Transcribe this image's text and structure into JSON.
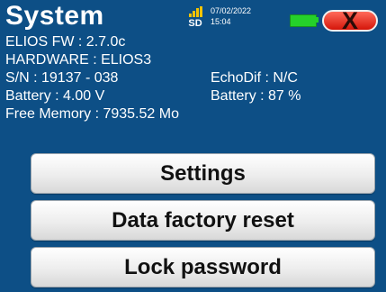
{
  "header": {
    "title": "System",
    "sd_label": "SD",
    "date": "07/02/2022",
    "time": "15:04",
    "close_symbol": "X",
    "colors": {
      "background": "#0d4f86",
      "battery": "#25d12a",
      "close": "#e3241b",
      "signal": "#f3c300"
    }
  },
  "info": {
    "firmware": "ELIOS FW : 2.7.0c",
    "hardware": "HARDWARE : ELIOS3",
    "serial": "S/N : 19137 - 038",
    "echodif": "EchoDif : N/C",
    "battery_voltage": "Battery : 4.00 V",
    "battery_percent": "Battery :  87 %",
    "free_memory": "Free Memory : 7935.52 Mo"
  },
  "menu": {
    "buttons": [
      {
        "label": "Settings"
      },
      {
        "label": "Data factory reset"
      },
      {
        "label": "Lock password"
      }
    ]
  },
  "icons": [
    "sd-card-icon",
    "battery-icon",
    "close-icon"
  ]
}
